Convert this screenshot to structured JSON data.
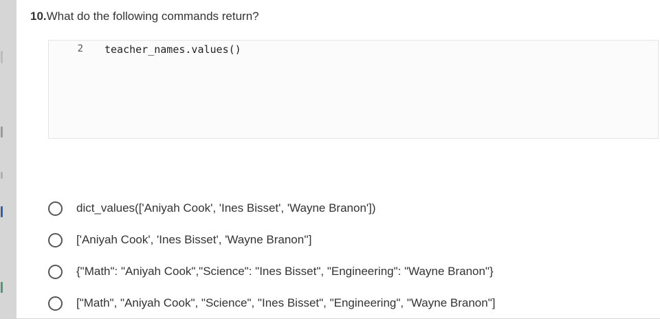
{
  "question": {
    "number": "10.",
    "text": "What do the following commands return?"
  },
  "code": {
    "lines": [
      {
        "number": "2",
        "text": "teacher_names.values()"
      }
    ]
  },
  "options": [
    {
      "label": "dict_values(['Aniyah Cook', 'Ines Bisset', 'Wayne Branon'])"
    },
    {
      "label": "['Aniyah Cook', 'Ines Bisset', 'Wayne Branon'']"
    },
    {
      "label": "{\"Math\": \"Aniyah Cook\",\"Science\": \"Ines Bisset\", \"Engineering\": \"Wayne Branon\"}"
    },
    {
      "label": "[\"Math\", \"Aniyah Cook\", \"Science\", \"Ines Bisset\", \"Engineering\", \"Wayne Branon\"]"
    }
  ],
  "colors": {
    "text": "#333333",
    "radio_border": "#555555",
    "code_background": "#fbfbfb",
    "page_background": "#ffffff",
    "left_strip": "#d6d6d6"
  }
}
